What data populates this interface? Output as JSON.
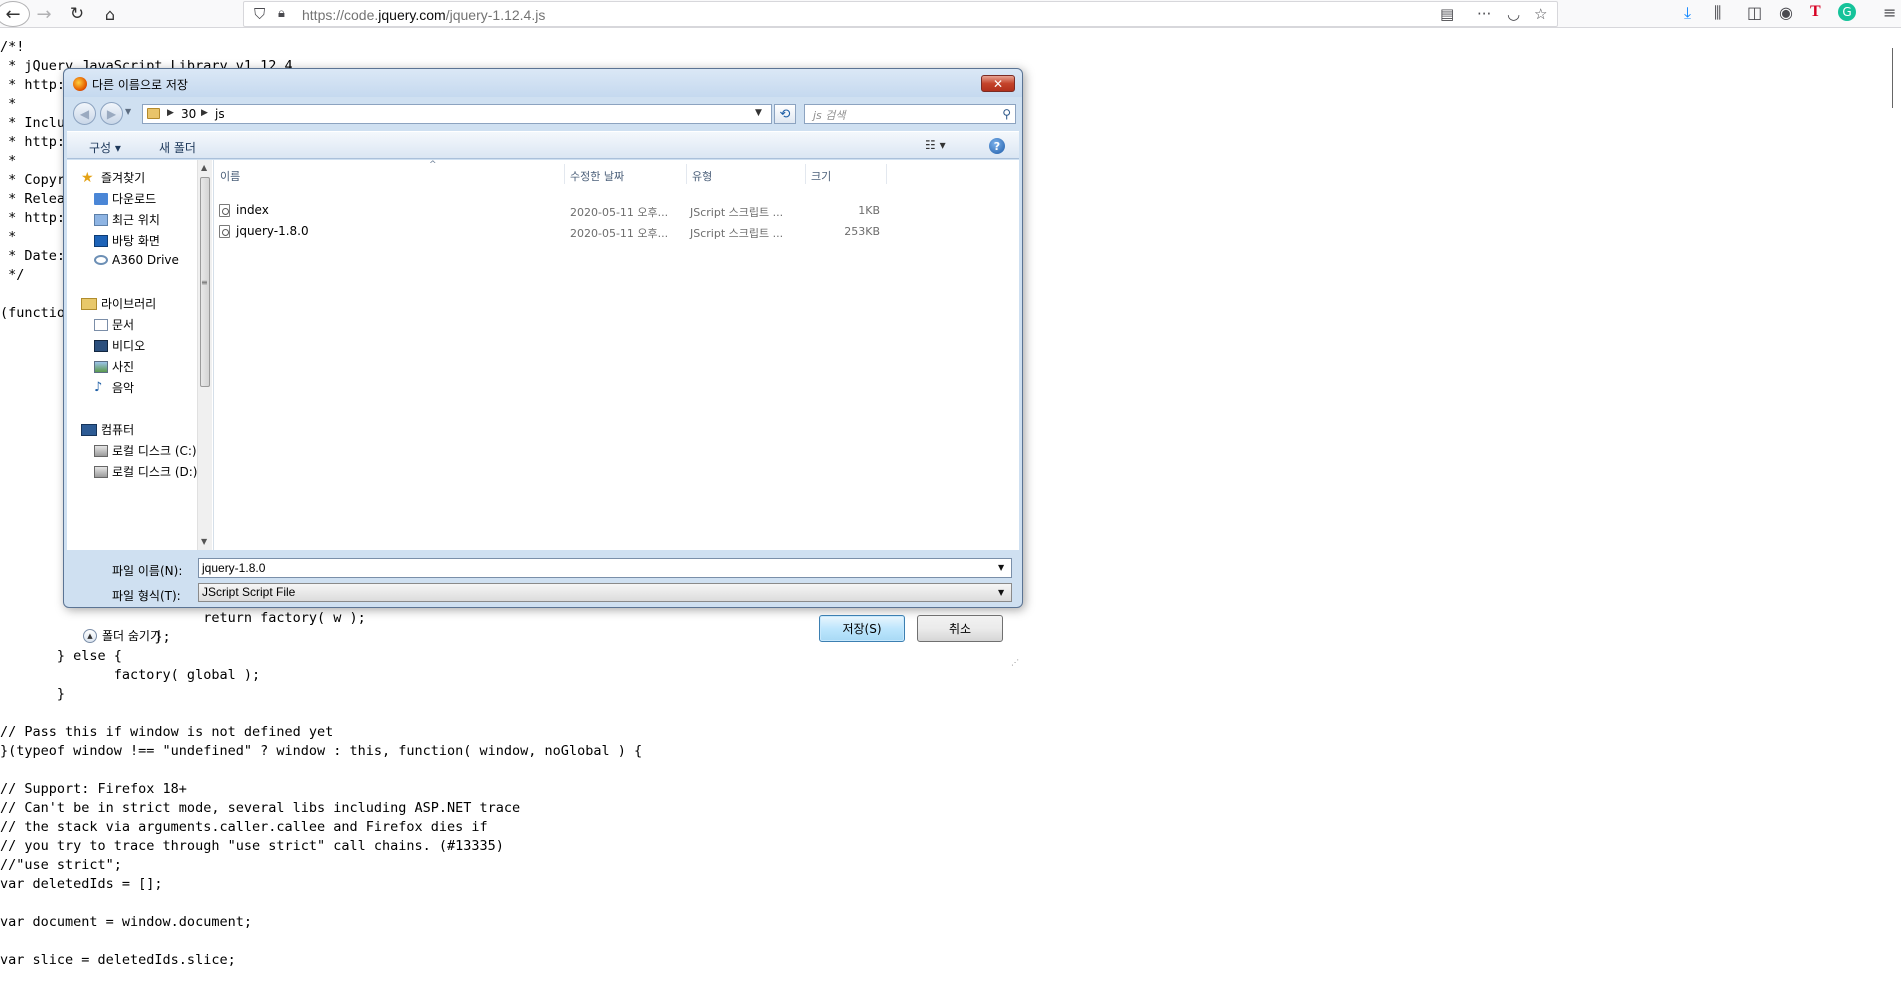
{
  "browser": {
    "url_prefix": "https://code.",
    "url_domain": "jquery.com",
    "url_path": "/jquery-1.12.4.js",
    "icons": {
      "back": "arrow-left-icon",
      "forward": "arrow-right-icon",
      "reload": "reload-icon",
      "home": "home-icon",
      "tracking": "shield-icon",
      "lock": "lock-icon",
      "reader": "reader-view-icon",
      "more": "more-icon",
      "pocket": "pocket-icon",
      "bookmark": "star-icon",
      "download": "download-icon",
      "library": "library-icon",
      "sidebar": "sidebar-icon",
      "account": "account-icon",
      "ext_t": "extension-t-icon",
      "ext_g": "grammarly-icon",
      "menu": "hamburger-menu-icon"
    }
  },
  "source_code": {
    "lines": [
      "/*!",
      " * jQuery JavaScript Library v1.12.4",
      " * http:",
      " *",
      " * Inclu",
      " * http:",
      " *",
      " * Copyr",
      " * Relea",
      " * http:",
      " *",
      " * Date:",
      " */",
      "",
      "(functio",
      "                         return factory( w );",
      "                   };",
      "       } else {",
      "              factory( global );",
      "       }",
      "",
      "// Pass this if window is not defined yet",
      "}(typeof window !== \"undefined\" ? window : this, function( window, noGlobal ) {",
      "",
      "// Support: Firefox 18+",
      "// Can't be in strict mode, several libs including ASP.NET trace",
      "// the stack via arguments.caller.callee and Firefox dies if",
      "// you try to trace through \"use strict\" call chains. (#13335)",
      "//\"use strict\";",
      "var deletedIds = [];",
      "",
      "var document = window.document;",
      "",
      "var slice = deletedIds.slice;"
    ]
  },
  "dialog": {
    "title": "다른 이름으로 저장",
    "close_label": "✕",
    "address": {
      "segments": [
        "30",
        "js"
      ]
    },
    "search_placeholder": "js 검색",
    "toolbar": {
      "organize": "구성 ▾",
      "new_folder": "새 폴더",
      "view": "☷ ▾",
      "help": "?"
    },
    "nav": {
      "favorites": "즐겨찾기",
      "downloads": "다운로드",
      "recent": "최근 위치",
      "desktop": "바탕 화면",
      "a360": "A360 Drive",
      "libraries": "라이브러리",
      "documents": "문서",
      "videos": "비디오",
      "pictures": "사진",
      "music": "음악",
      "computer": "컴퓨터",
      "drive_c": "로컬 디스크 (C:)",
      "drive_d": "로컬 디스크 (D:)"
    },
    "columns": {
      "name": "이름",
      "modified": "수정한 날짜",
      "type": "유형",
      "size": "크기"
    },
    "files": [
      {
        "name": "index",
        "modified": "2020-05-11 오후...",
        "type": "JScript 스크립트 ...",
        "size": "1KB"
      },
      {
        "name": "jquery-1.8.0",
        "modified": "2020-05-11 오후...",
        "type": "JScript 스크립트 ...",
        "size": "253KB"
      }
    ],
    "file_name_label": "파일 이름(N):",
    "file_name_value": "jquery-1.8.0",
    "file_type_label": "파일 형식(T):",
    "file_type_value": "JScript Script File",
    "hide_folders": "폴더 숨기기",
    "save_label": "저장(S)",
    "cancel_label": "취소"
  }
}
